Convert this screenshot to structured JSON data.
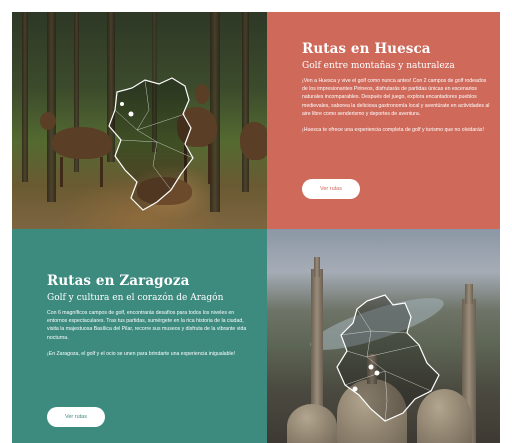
{
  "huesca": {
    "title": "Rutas en Huesca",
    "subtitle": "Golf entre montañas y naturaleza",
    "paragraph1": "¡Ven a Huesca y vive el golf como nunca antes! Con 2 campos de golf rodeados de los impresionantes Pirineos, disfrutarás de partidas únicas en escenarios naturales incomparables. Después del juego, explora encantadores pueblos medievales, saborea la deliciosa gastronomía local y aventúrate en actividades al aire libre como senderismo y deportes de aventura.",
    "paragraph2": "¡Huesca te ofrece una experiencia completa de golf y turismo que no olvidarás!",
    "button": "Ver rutas"
  },
  "zaragoza": {
    "title": "Rutas en Zaragoza",
    "subtitle": "Golf y cultura en el corazón de Aragón",
    "paragraph1": "Con 6 magníficos campos de golf, encontrarás desafíos para todos los niveles en entornos espectaculares. Tras tus partidas, sumérgete en la rica historia de la ciudad, visita la majestuosa Basílica del Pilar, recorre sus museos y disfruta de la vibrante vida nocturna.",
    "paragraph2": "¡En Zaragoza, el golf y el ocio se unen para brindarte una experiencia inigualable!",
    "button": "Ver rutas"
  },
  "colors": {
    "huesca_panel": "#cf6a5b",
    "zaragoza_panel": "#3d8a7f",
    "text": "#ffffff"
  },
  "icons": [
    "province-map-outline-huesca",
    "province-map-outline-zaragoza",
    "location-dot-icon"
  ]
}
